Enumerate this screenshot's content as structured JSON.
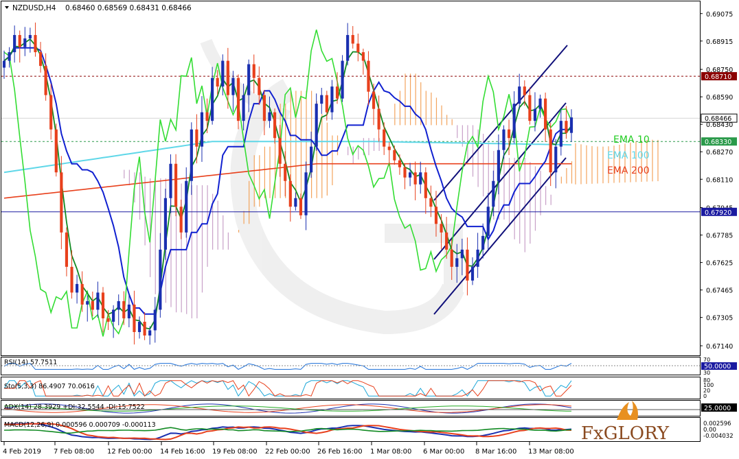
{
  "header": {
    "symbol": "NZDUSD,H4",
    "ohlc": "0.68460 0.68569 0.68431 0.68466"
  },
  "legend": {
    "ema10": "EMA 10",
    "ema100": "EMA 100",
    "ema200": "EMA 200"
  },
  "indicators": {
    "rsi": "RSI(14) 57.7511",
    "sto": "Sto(5,3,3) 86.4907 70.0616",
    "adx": "ADX(14) 28.3929 +DI:32.5544 -DI:15.7522",
    "macd": "MACD(12,26,9) 0.000596 0.000709 -0.000113"
  },
  "right_axis": {
    "rsi_tag": "50.0000",
    "rsi_top": "70",
    "rsi_bot": "30",
    "sto_a": "80",
    "sto_b": "100",
    "sto_c": "20",
    "sto_d": "0",
    "adx_tag": "25.0000",
    "macd_top": "0.002596",
    "macd_zero": "0.00",
    "macd_bot": "-0.004032"
  },
  "brand": "FxGLORY",
  "colors": {
    "bull": "#1a2fb0",
    "bear": "#e8401c",
    "ema10": "#22cc22",
    "ema100": "#5fd7e8",
    "ema200": "#e8401c",
    "resistance": "#8b0000",
    "support": "#1a1aa0",
    "channel": "#10107a",
    "cloud_bull": "#f3a35c",
    "cloud_bear": "#c8a0c8"
  },
  "chart_data": {
    "type": "candlestick",
    "price_scale": [
      "0.69075",
      "0.68915",
      "0.68750",
      "0.68590",
      "0.68430",
      "0.68270",
      "0.68110",
      "0.67945",
      "0.67785",
      "0.67625",
      "0.67465",
      "0.67305",
      "0.67140"
    ],
    "ylim": [
      0.671,
      0.6913
    ],
    "x_ticks": [
      "4 Feb 2019",
      "7 Feb 08:00",
      "12 Feb 00:00",
      "14 Feb 16:00",
      "19 Feb 08:00",
      "22 Feb 00:00",
      "26 Feb 16:00",
      "1 Mar 08:00",
      "6 Mar 00:00",
      "8 Mar 16:00",
      "13 Mar 08:00"
    ],
    "levels": [
      {
        "label": "0.68710",
        "value": 0.6871,
        "kind": "resistance"
      },
      {
        "label": "0.68466",
        "value": 0.68466,
        "kind": "current"
      },
      {
        "label": "0.68330",
        "value": 0.6833,
        "kind": "ema10"
      },
      {
        "label": "0.67920",
        "value": 0.6792,
        "kind": "support"
      }
    ],
    "close": [
      0.688,
      0.6885,
      0.6895,
      0.6888,
      0.6893,
      0.6895,
      0.6885,
      0.6877,
      0.686,
      0.684,
      0.6815,
      0.678,
      0.676,
      0.6745,
      0.675,
      0.6738,
      0.674,
      0.6735,
      0.6745,
      0.673,
      0.6728,
      0.6735,
      0.674,
      0.673,
      0.6738,
      0.6722,
      0.6728,
      0.672,
      0.6723,
      0.6735,
      0.677,
      0.68,
      0.682,
      0.6795,
      0.678,
      0.681,
      0.684,
      0.683,
      0.685,
      0.6845,
      0.687,
      0.6865,
      0.688,
      0.686,
      0.687,
      0.6845,
      0.686,
      0.6878,
      0.687,
      0.686,
      0.6845,
      0.685,
      0.6835,
      0.682,
      0.681,
      0.6795,
      0.68,
      0.679,
      0.6815,
      0.683,
      0.6855,
      0.686,
      0.685,
      0.6865,
      0.6858,
      0.688,
      0.6895,
      0.689,
      0.6885,
      0.688,
      0.6862,
      0.6852,
      0.684,
      0.683,
      0.6828,
      0.6822,
      0.6818,
      0.6812,
      0.6815,
      0.6808,
      0.6815,
      0.68,
      0.6795,
      0.6785,
      0.678,
      0.677,
      0.676,
      0.6765,
      0.677,
      0.6752,
      0.676,
      0.677,
      0.6778,
      0.6795,
      0.681,
      0.6828,
      0.684,
      0.6835,
      0.6855,
      0.6865,
      0.686,
      0.6845,
      0.6852,
      0.6858,
      0.684,
      0.6815,
      0.683,
      0.6845,
      0.6838,
      0.6847
    ]
  }
}
